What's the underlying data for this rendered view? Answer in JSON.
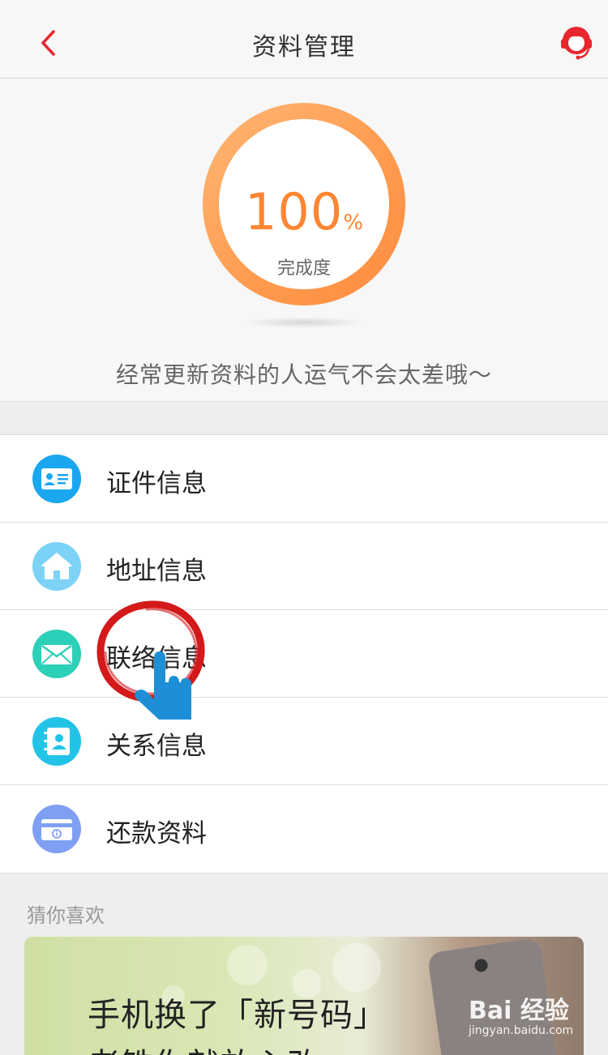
{
  "header": {
    "title": "资料管理",
    "back_icon": "chevron-left-icon",
    "service_icon": "customer-service-icon"
  },
  "progress": {
    "value": "100",
    "unit": "%",
    "label": "完成度",
    "fraction": 1.0
  },
  "slogan": "经常更新资料的人运气不会太差哦～",
  "menu": {
    "items": [
      {
        "label": "证件信息",
        "icon": "id-card-icon",
        "color": "#1aa7f0"
      },
      {
        "label": "地址信息",
        "icon": "home-icon",
        "color": "#7dd3f7"
      },
      {
        "label": "联络信息",
        "icon": "envelope-icon",
        "color": "#2ccfb7"
      },
      {
        "label": "关系信息",
        "icon": "contacts-book-icon",
        "color": "#23c3e8"
      },
      {
        "label": "还款资料",
        "icon": "bank-card-icon",
        "color": "#7f9ff3"
      }
    ]
  },
  "recommend": {
    "title": "猜你喜欢",
    "banner_line1": "手机换了「新号码」",
    "banner_line2": "老铁你就放心改"
  },
  "watermark": {
    "main": "Bai 经验",
    "sub": "jingyan.baidu.com"
  },
  "colors": {
    "accent": "#ff8632",
    "brand_red": "#e8262e",
    "annotation": "#d4191a",
    "hand": "#1e8fd6"
  }
}
